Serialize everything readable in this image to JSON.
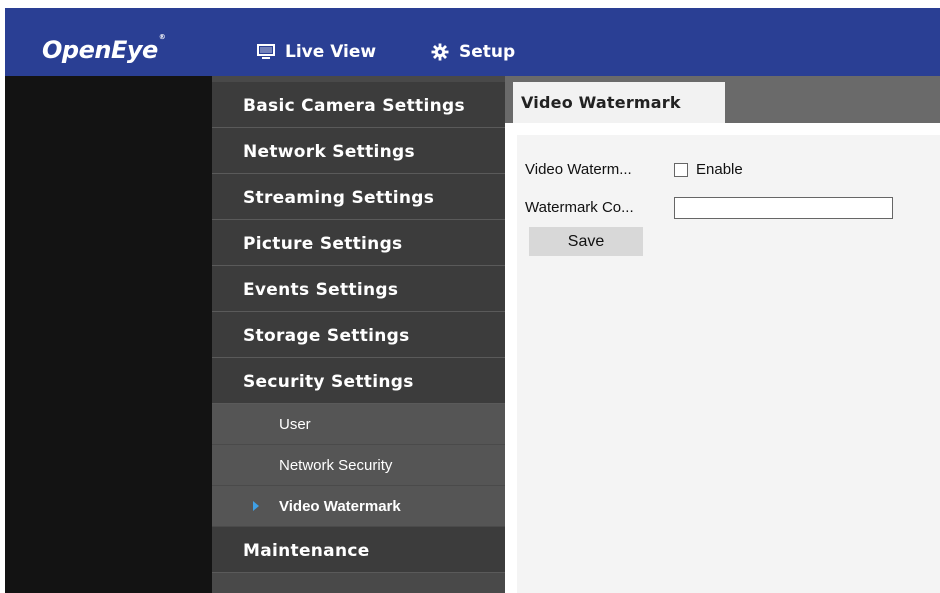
{
  "header": {
    "logo": "OpenEye",
    "logo_mark": "®",
    "nav": [
      {
        "label": "Live View",
        "icon": "monitor-icon"
      },
      {
        "label": "Setup",
        "icon": "gear-icon"
      }
    ]
  },
  "sidebar": {
    "items": [
      {
        "label": "Basic Camera Settings"
      },
      {
        "label": "Network Settings"
      },
      {
        "label": "Streaming Settings"
      },
      {
        "label": "Picture Settings"
      },
      {
        "label": "Events Settings"
      },
      {
        "label": "Storage Settings"
      },
      {
        "label": "Security Settings"
      }
    ],
    "sub_items": [
      {
        "label": "User"
      },
      {
        "label": "Network Security"
      },
      {
        "label": "Video Watermark",
        "active": true
      }
    ],
    "after_items": [
      {
        "label": "Maintenance"
      }
    ]
  },
  "main": {
    "tab_label": "Video Watermark",
    "form": {
      "watermark_label": "Video Waterm...",
      "enable_label": "Enable",
      "enable_checked": false,
      "content_label": "Watermark Co...",
      "content_value": "",
      "save_label": "Save"
    }
  },
  "colors": {
    "topbar": "#2a3f94",
    "sidebar_item": "#3c3c3c",
    "sidebar_sub": "#555555",
    "active_arrow": "#3fa0e6",
    "tabstrip": "#6a6a6a"
  }
}
